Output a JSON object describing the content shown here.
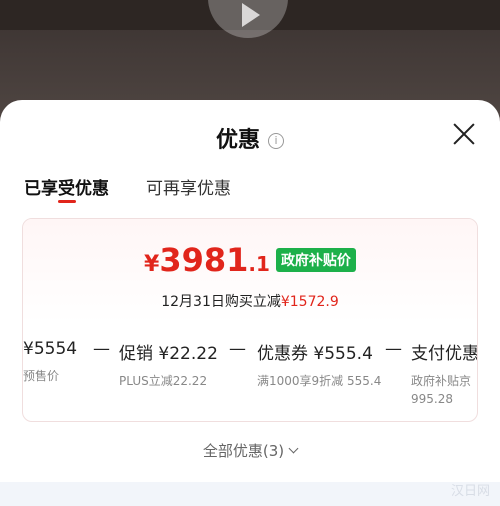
{
  "sheet": {
    "title": "优惠",
    "info_icon": "i"
  },
  "tabs": [
    {
      "label": "已享受优惠"
    },
    {
      "label": "可再享优惠"
    }
  ],
  "price": {
    "currency": "¥",
    "integer": "3981",
    "decimal": ".1",
    "badge": "政府补贴价",
    "countdown_prefix": "12月31日购买立减",
    "countdown_amount": "¥1572.9"
  },
  "calc": [
    {
      "amount": "¥5554",
      "sub": "预售价"
    },
    {
      "amount": "促销 ¥22.22",
      "sub": "PLUS立减22.22"
    },
    {
      "amount": "优惠券 ¥555.4",
      "sub": "满1000享9折减 555.4"
    },
    {
      "amount": "支付优惠",
      "sub": "政府补贴京 995.28"
    }
  ],
  "operators": [
    "—",
    "—",
    "—"
  ],
  "footer": {
    "all_discounts": "全部优惠(3)"
  },
  "watermark": "汉日网",
  "colors": {
    "accent": "#e1251b",
    "badge": "#1db04a"
  }
}
